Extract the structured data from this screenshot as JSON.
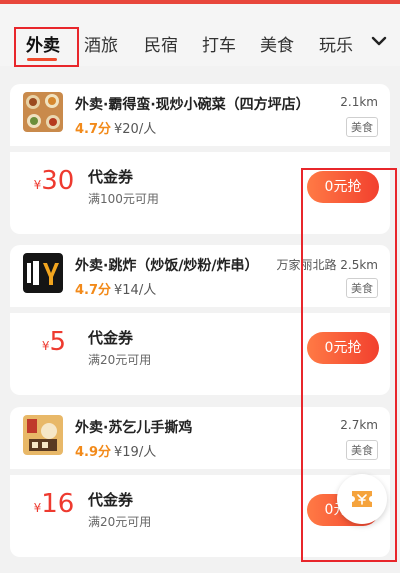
{
  "tabs": [
    {
      "label": "外卖",
      "active": true
    },
    {
      "label": "酒旅"
    },
    {
      "label": "民宿"
    },
    {
      "label": "打车"
    },
    {
      "label": "美食"
    },
    {
      "label": "玩乐"
    }
  ],
  "stores": [
    {
      "name": "外卖·霸得蛮·现炒小碗菜（四方坪店）",
      "rating": "4.7分",
      "avg_price": "¥20/人",
      "distance": "2.1km",
      "category": "美食",
      "coupon": {
        "currency": "¥",
        "amount": "30",
        "title": "代金券",
        "condition": "满100元可用",
        "button": "0元抢"
      }
    },
    {
      "name": "外卖·跳炸（炒饭/炒粉/炸串）",
      "rating": "4.7分",
      "avg_price": "¥14/人",
      "distance": "万家丽北路 2.5km",
      "category": "美食",
      "coupon": {
        "currency": "¥",
        "amount": "5",
        "title": "代金券",
        "condition": "满20元可用",
        "button": "0元抢"
      }
    },
    {
      "name": "外卖·苏乞儿手撕鸡",
      "rating": "4.9分",
      "avg_price": "¥19/人",
      "distance": "2.7km",
      "category": "美食",
      "coupon": {
        "currency": "¥",
        "amount": "16",
        "title": "代金券",
        "condition": "满20元可用",
        "button": "0元抢"
      }
    }
  ],
  "floating_button": {
    "icon": "coupon-ticket-icon"
  },
  "colors": {
    "accent": "#f04a2c",
    "rating": "#f28a1a",
    "highlight": "#e8262b"
  }
}
